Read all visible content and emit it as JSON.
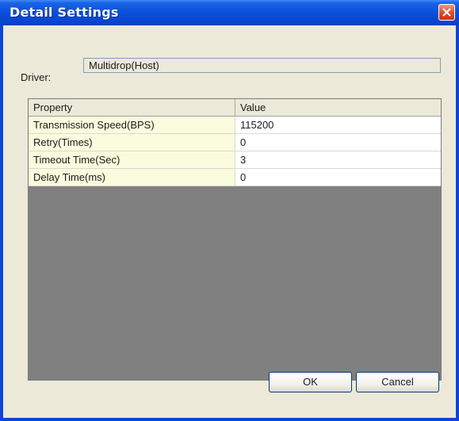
{
  "window": {
    "title": "Detail Settings",
    "close_icon": "close-icon"
  },
  "driver": {
    "label": "Driver:",
    "value": "Multidrop(Host)"
  },
  "grid": {
    "columns": [
      "Property",
      "Value"
    ],
    "rows": [
      {
        "property": "Transmission Speed(BPS)",
        "value": "115200"
      },
      {
        "property": "Retry(Times)",
        "value": "0"
      },
      {
        "property": "Timeout Time(Sec)",
        "value": "3"
      },
      {
        "property": "Delay Time(ms)",
        "value": "0"
      }
    ]
  },
  "buttons": {
    "ok": "OK",
    "cancel": "Cancel"
  },
  "colors": {
    "titlebar": "#0a45d6",
    "property_cell_bg": "#fbfbdd",
    "grid_empty_bg": "#808080",
    "dialog_bg": "#ece9d8",
    "close_button": "#de4a1f"
  }
}
